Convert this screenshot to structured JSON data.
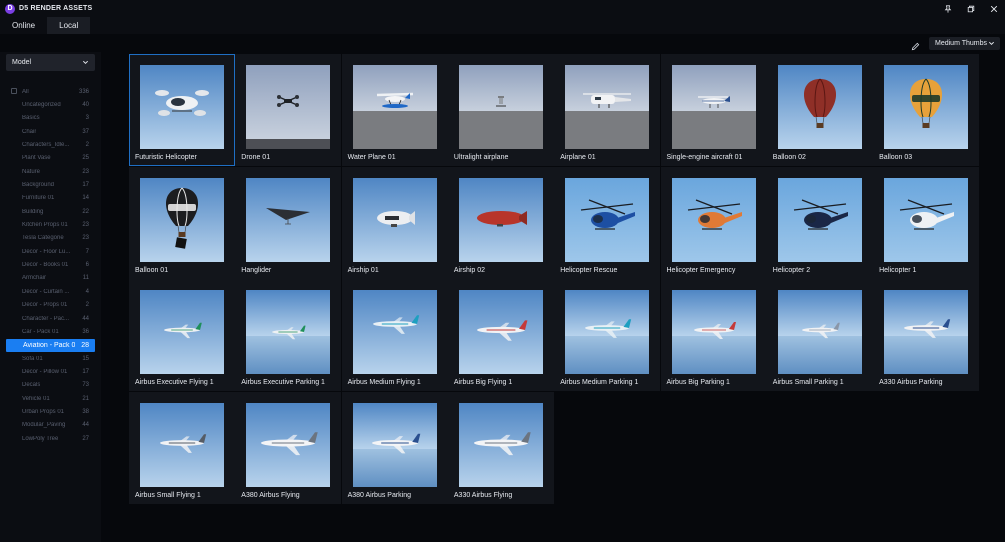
{
  "app": {
    "title": "D5 RENDER ASSETS",
    "logo_glyph": "D"
  },
  "window_controls": [
    "pin-icon",
    "restore-icon",
    "close-icon"
  ],
  "tabs": [
    {
      "label": "Online",
      "active": false
    },
    {
      "label": "Local",
      "active": true
    }
  ],
  "toolbar": {
    "thumb_size": "Medium Thumbs"
  },
  "sidebar": {
    "category": "Model",
    "items": [
      {
        "label": "All",
        "count": "336"
      },
      {
        "label": "Uncategorized",
        "count": "40"
      },
      {
        "label": "Basics",
        "count": "3"
      },
      {
        "label": "Chair",
        "count": "37"
      },
      {
        "label": "Characters_Idle...",
        "count": "2"
      },
      {
        "label": "Plant Vase",
        "count": "25"
      },
      {
        "label": "Nature",
        "count": "23"
      },
      {
        "label": "Background",
        "count": "17"
      },
      {
        "label": "Furniture 01",
        "count": "14"
      },
      {
        "label": "Building",
        "count": "22"
      },
      {
        "label": "Kitchen Props 01",
        "count": "23"
      },
      {
        "label": "Tesla Categorie",
        "count": "23"
      },
      {
        "label": "Decor - Floor Lu...",
        "count": "7"
      },
      {
        "label": "Decor - Books 01",
        "count": "6"
      },
      {
        "label": "Armchair",
        "count": "11"
      },
      {
        "label": "Decor - Curtain ...",
        "count": "4"
      },
      {
        "label": "Decor - Props 01",
        "count": "2"
      },
      {
        "label": "Character - Pac...",
        "count": "44"
      },
      {
        "label": "Car - Pack 01",
        "count": "36"
      },
      {
        "label": "Aviation - Pack 01",
        "count": "28",
        "active": true
      },
      {
        "label": "Sofa 01",
        "count": "15"
      },
      {
        "label": "Decor - Pillow 01",
        "count": "17"
      },
      {
        "label": "Decals",
        "count": "73"
      },
      {
        "label": "Vehicle 01",
        "count": "21"
      },
      {
        "label": "Urban Props 01",
        "count": "38"
      },
      {
        "label": "Modular_Paving",
        "count": "44"
      },
      {
        "label": "LowPoly Tree",
        "count": "27"
      }
    ]
  },
  "assets": [
    {
      "name": "Futuristic Helicopter",
      "kind": "futuristic-heli",
      "bg": "sky",
      "selected": true
    },
    {
      "name": "Drone 01",
      "kind": "drone",
      "bg": "sky-dark"
    },
    {
      "name": "Water Plane 01",
      "kind": "waterplane",
      "bg": "sky-ground"
    },
    {
      "name": "Ultralight airplane",
      "kind": "ultralight",
      "bg": "sky-ground"
    },
    {
      "name": "Airplane 01",
      "kind": "cargo",
      "bg": "sky-ground"
    },
    {
      "name": "Single-engine aircraft 01",
      "kind": "singleengine",
      "bg": "sky-ground"
    },
    {
      "name": "Balloon 02",
      "kind": "balloon-red",
      "bg": "sky"
    },
    {
      "name": "Balloon 03",
      "kind": "balloon-orange",
      "bg": "sky"
    },
    {
      "name": "Balloon 01",
      "kind": "balloon-black",
      "bg": "sky"
    },
    {
      "name": "Hanglider",
      "kind": "hanglider",
      "bg": "sky"
    },
    {
      "name": "Airship 01",
      "kind": "airship-white",
      "bg": "sky"
    },
    {
      "name": "Airship 02",
      "kind": "airship-red",
      "bg": "sky"
    },
    {
      "name": "Helicopter Rescue",
      "kind": "heli-blue",
      "bg": "sky-blue"
    },
    {
      "name": "Helicopter Emergency",
      "kind": "heli-orange",
      "bg": "sky-blue"
    },
    {
      "name": "Helicopter 2",
      "kind": "heli-navy",
      "bg": "sky-blue"
    },
    {
      "name": "Helicopter 1",
      "kind": "heli-white",
      "bg": "sky-blue"
    },
    {
      "name": "Airbus Executive Flying 1",
      "kind": "jet-green",
      "bg": "sky"
    },
    {
      "name": "Airbus Executive Parking 1",
      "kind": "jet-green-small",
      "bg": "sky-horizon"
    },
    {
      "name": "Airbus Medium Flying 1",
      "kind": "jet-teal",
      "bg": "sky"
    },
    {
      "name": "Airbus Big Flying 1",
      "kind": "jet-red",
      "bg": "sky"
    },
    {
      "name": "Airbus Medium Parking 1",
      "kind": "jet-teal-small",
      "bg": "sky-horizon"
    },
    {
      "name": "Airbus Big Parking 1",
      "kind": "jet-red-small",
      "bg": "sky-horizon"
    },
    {
      "name": "Airbus Small Parking 1",
      "kind": "jet-white-small",
      "bg": "sky-horizon"
    },
    {
      "name": "A330 Airbus Parking",
      "kind": "jet-blue-small",
      "bg": "sky-horizon"
    },
    {
      "name": "Airbus Small Flying 1",
      "kind": "jet-white",
      "bg": "sky"
    },
    {
      "name": "A380 Airbus Flying",
      "kind": "jet-white-big",
      "bg": "sky"
    },
    {
      "name": "A380 Airbus Parking",
      "kind": "jet-white-mid",
      "bg": "sky-horizon"
    },
    {
      "name": "A330 Airbus Flying",
      "kind": "jet-white-big",
      "bg": "sky"
    }
  ],
  "colors": {
    "accent": "#1a7ef2",
    "selection_border": "#1f6fc4",
    "background": "#06080c",
    "panel": "#0b0d12",
    "card": "#12151b"
  }
}
